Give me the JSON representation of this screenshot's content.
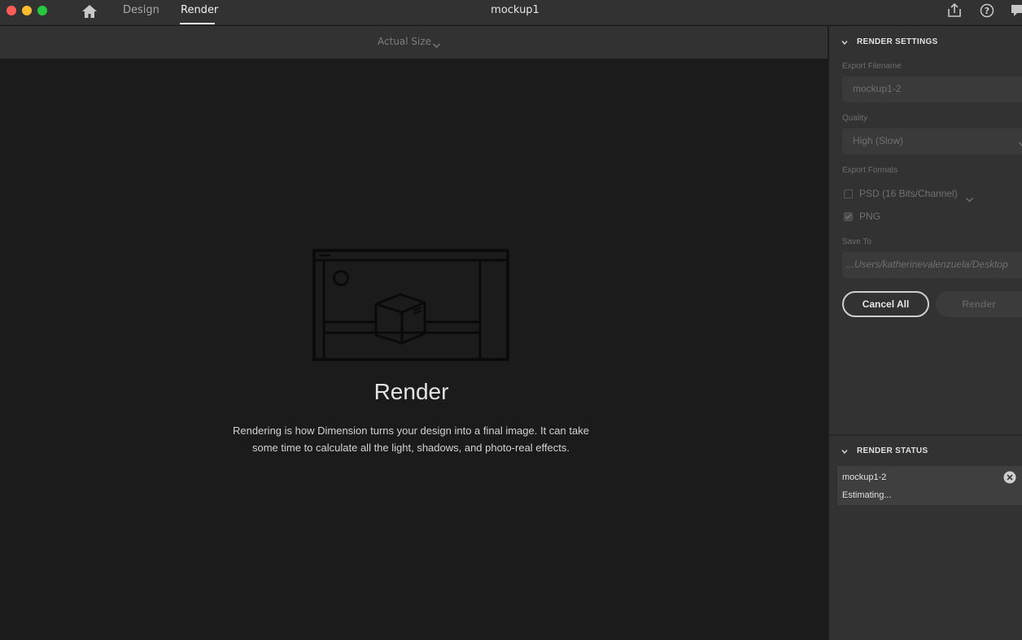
{
  "window": {
    "title": "mockup1",
    "tabs": [
      {
        "label": "Design",
        "active": false
      },
      {
        "label": "Render",
        "active": true
      }
    ],
    "icons": [
      "home-icon",
      "share-icon",
      "help-icon",
      "chat-icon"
    ]
  },
  "viewport": {
    "zoom_label": "Actual Size"
  },
  "canvas": {
    "heading": "Render",
    "description": "Rendering is how Dimension turns your design into a final image. It can take some time to calculate all the light, shadows, and photo-real effects."
  },
  "render_settings": {
    "section_title": "RENDER SETTINGS",
    "filename_label": "Export Filename",
    "filename_value": "mockup1-2",
    "quality_label": "Quality",
    "quality_value": "High (Slow)",
    "formats_label": "Export Formats",
    "formats": [
      {
        "label": "PSD (16 Bits/Channel)",
        "checked": false
      },
      {
        "label": "PNG",
        "checked": true
      }
    ],
    "save_to_label": "Save To",
    "save_to_value": "...Users/katherinevalenzuela/Desktop",
    "cancel_label": "Cancel All",
    "render_label": "Render"
  },
  "render_status": {
    "section_title": "RENDER STATUS",
    "items": [
      {
        "name": "mockup1-2",
        "status": "Estimating..."
      }
    ]
  },
  "colors": {
    "title_bar": "#323232",
    "canvas": "#1b1b1b",
    "panel": "#323232",
    "traffic_red": "#fd5d56",
    "traffic_yellow": "#fdbb2e",
    "traffic_green": "#27c73f"
  }
}
